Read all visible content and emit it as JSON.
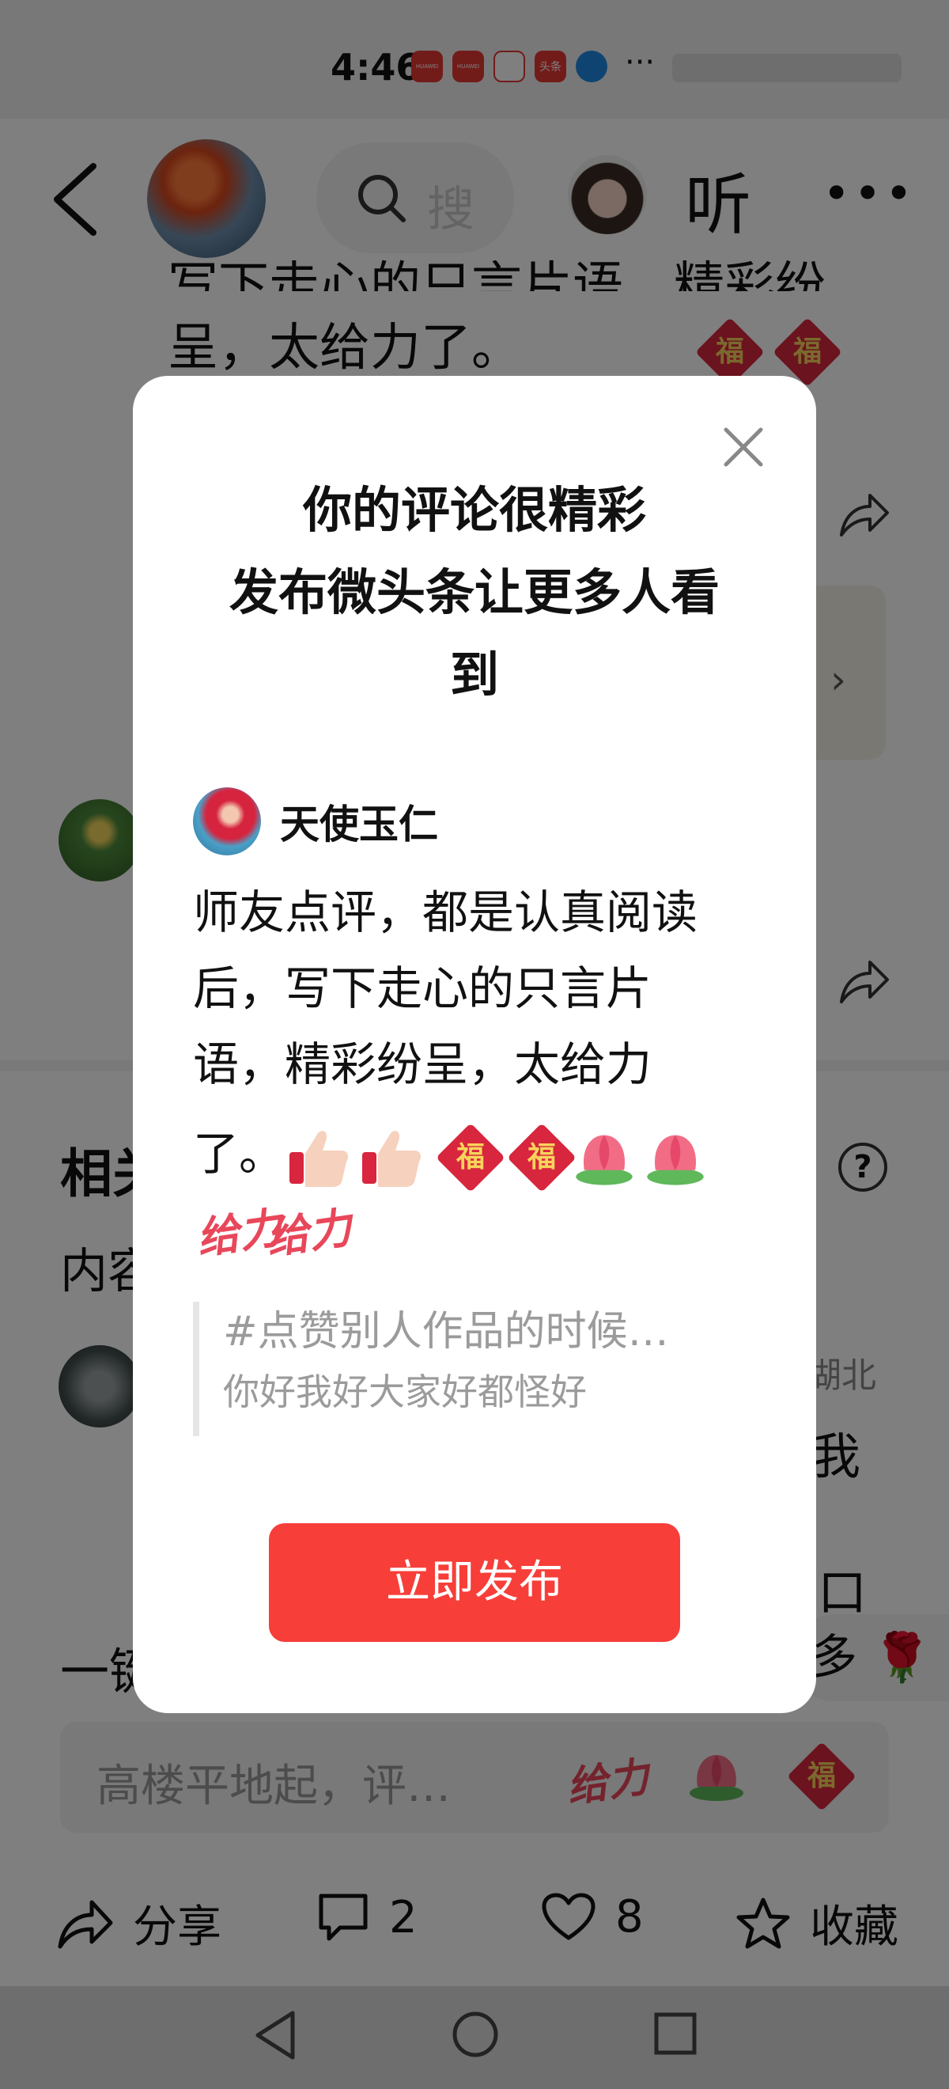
{
  "status_bar": {
    "time": "4:46",
    "app_icons": [
      "HUAWEI",
      "HUAWEI",
      "",
      "头条",
      ""
    ],
    "more": "···"
  },
  "topbar": {
    "search_placeholder": "搜",
    "listen_label": "听"
  },
  "background": {
    "comment_line1": "写下走心的只言片语，精彩纷",
    "comment_line2": "呈，太给力了。",
    "related_title": "相关",
    "content_label": "内容",
    "location": "湖北",
    "wo": "我",
    "kou": "口",
    "yijian": "一键",
    "duo": "多",
    "comment_placeholder": "高楼平地起，评…",
    "help": "?"
  },
  "bottom_actions": {
    "share_label": "分享",
    "comment_count": "2",
    "like_count": "8",
    "favorite_label": "收藏"
  },
  "modal": {
    "title_line1": "你的评论很精彩",
    "title_line2": "发布微头条让更多人看",
    "title_line3": "到",
    "author_name": "天使玉仁",
    "comment_line1": "师友点评，都是认真阅读",
    "comment_line2": "后，写下走心的只言片",
    "comment_line3": "语，精彩纷呈，太给力",
    "comment_line4": "了。",
    "sticker_geili": "给力",
    "sticker_fu": "福",
    "quote_title": "#点赞别人作品的时候…",
    "quote_sub": "你好我好大家好都怪好",
    "publish_label": "立即发布"
  },
  "colors": {
    "accent": "#f73e39",
    "overlay": "rgba(0,0,0,0.5)"
  }
}
